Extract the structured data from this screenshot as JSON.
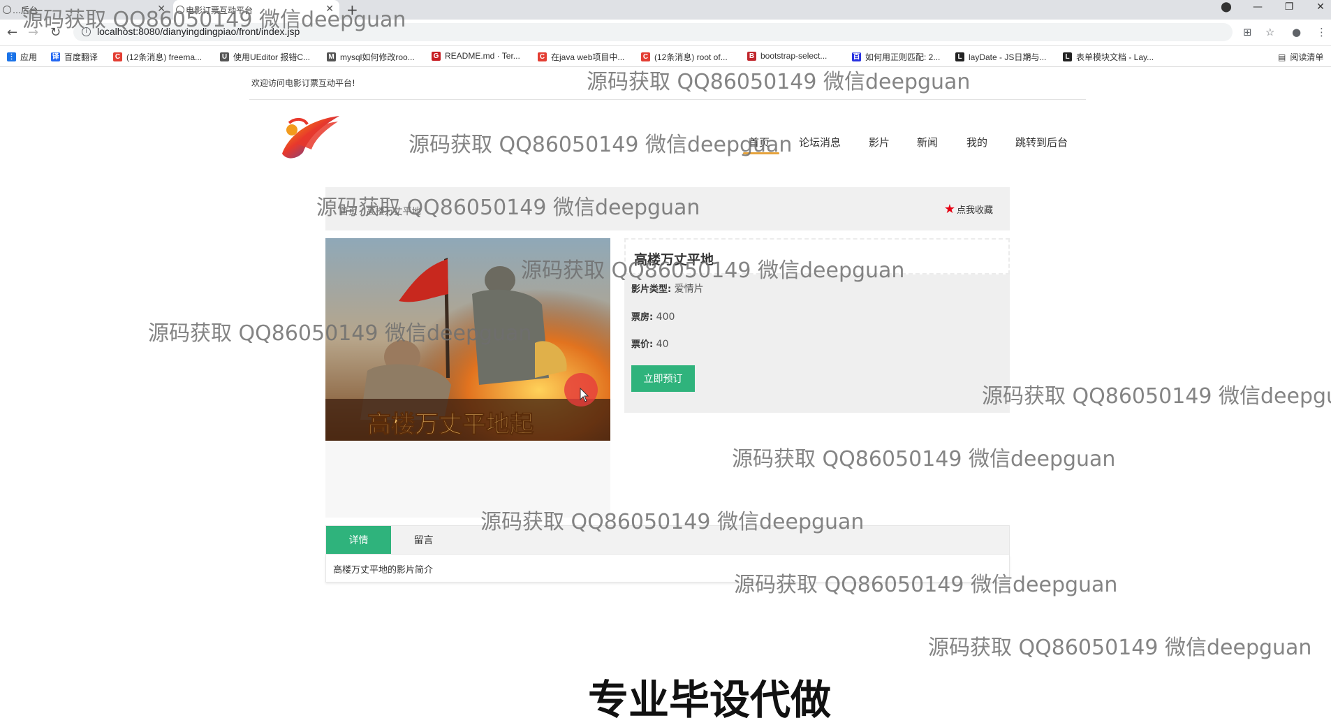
{
  "browser": {
    "tabs": [
      {
        "label": "…后台",
        "active": false
      },
      {
        "label": "电影订票互动平台",
        "active": true
      }
    ],
    "url": "localhost:8080/dianyingdingpiao/front/index.jsp",
    "bookmarks": [
      {
        "label": "应用",
        "icon": "apps-icon",
        "color": "#1a73e8"
      },
      {
        "label": "百度翻译",
        "icon": "baidu-translate-icon",
        "color": "#2468f2"
      },
      {
        "label": "(12条消息) freema...",
        "icon": "csdn-icon",
        "color": "#e33e33"
      },
      {
        "label": "使用UEditor 报错C...",
        "icon": "ueditor-icon",
        "color": "#555555"
      },
      {
        "label": "mysql如何修改roo...",
        "icon": "mysql-icon",
        "color": "#555555"
      },
      {
        "label": "README.md · Ter...",
        "icon": "gitee-icon",
        "color": "#c71d23"
      },
      {
        "label": "在java web项目中...",
        "icon": "csdn-icon",
        "color": "#e33e33"
      },
      {
        "label": "(12条消息) root of...",
        "icon": "csdn-icon",
        "color": "#e33e33"
      },
      {
        "label": "bootstrap-select...",
        "icon": "bootstrap-icon",
        "color": "#c1272d"
      },
      {
        "label": "如何用正则匹配: 2...",
        "icon": "baidu-icon",
        "color": "#2932e1"
      },
      {
        "label": "layDate - JS日期与...",
        "icon": "layui-icon",
        "color": "#222222"
      },
      {
        "label": "表单模块文档 - Lay...",
        "icon": "layui-icon",
        "color": "#222222"
      }
    ],
    "reading_list": "阅读清单"
  },
  "page": {
    "welcome": "欢迎访问电影订票互动平台!",
    "nav": [
      {
        "label": "首页",
        "active": true
      },
      {
        "label": "论坛消息",
        "active": false
      },
      {
        "label": "影片",
        "active": false
      },
      {
        "label": "新闻",
        "active": false
      },
      {
        "label": "我的",
        "active": false
      },
      {
        "label": "跳转到后台",
        "active": false
      }
    ],
    "breadcrumb": "首页 / 高楼万丈平地",
    "favorite_label": "点我收藏",
    "movie": {
      "title": "高楼万丈平地",
      "type_label": "影片类型:",
      "type_value": "爱情片",
      "boxoffice_label": "票房:",
      "boxoffice_value": "400",
      "price_label": "票价:",
      "price_value": "40",
      "book_button": "立即预订",
      "poster_text": "高楼万丈平地起"
    },
    "detail_tabs": [
      {
        "label": "详情",
        "active": true
      },
      {
        "label": "留言",
        "active": false
      }
    ],
    "detail_content": "高楼万丈平地的影片简介"
  },
  "overlay": {
    "watermark": "源码获取 QQ86050149 微信deepguan",
    "watermark_short": "源码获取 QQ86050149 微信deepgu",
    "caption": "专业毕设代做"
  },
  "colors": {
    "accent_green": "#2fb37c",
    "nav_underline": "#e6a33c",
    "star_red": "#e60012"
  }
}
